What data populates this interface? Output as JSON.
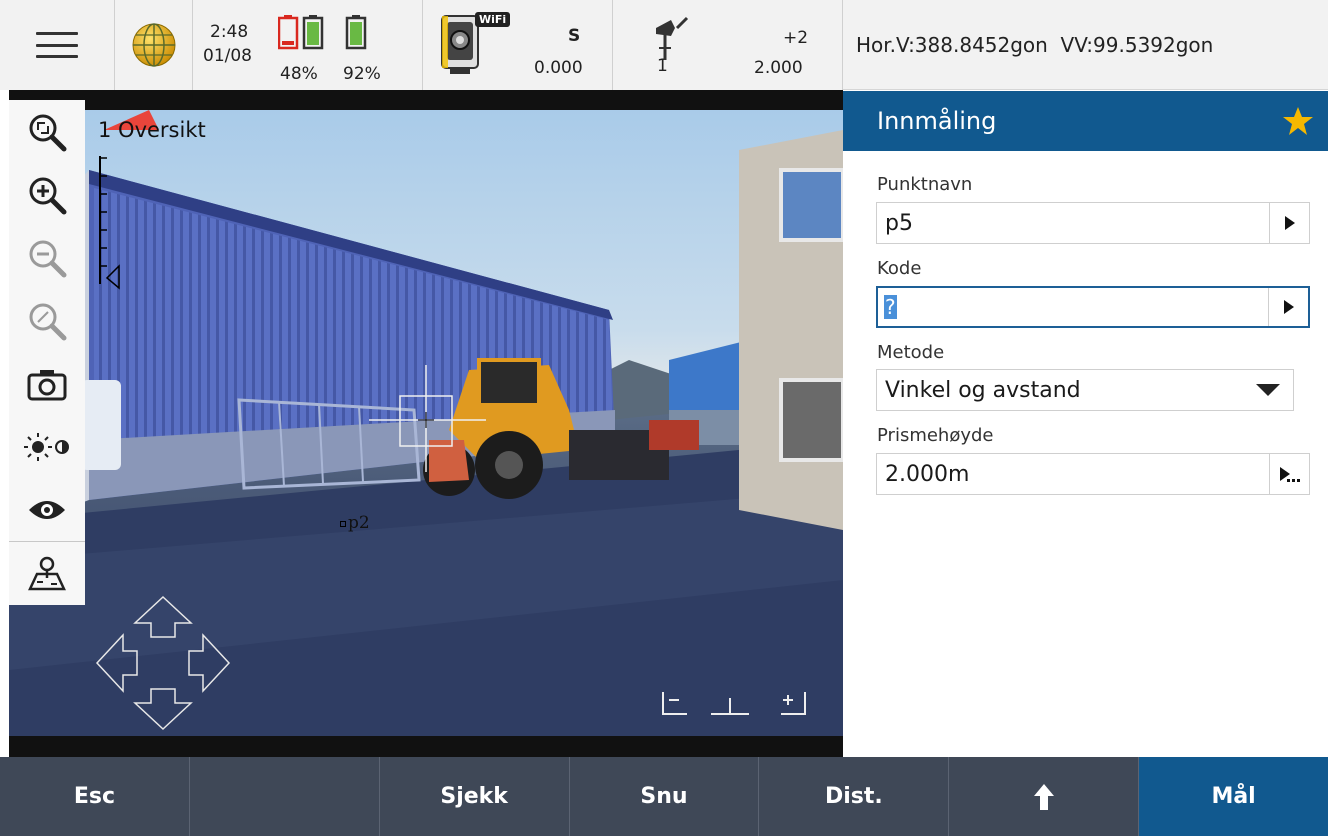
{
  "status": {
    "time": "2:48",
    "date": "01/08",
    "battery_left_pct": "48%",
    "battery_right_pct": "92%",
    "wifi_label": "WiFi",
    "instrument_face": "S",
    "instrument_value": "0.000",
    "target_number": "1",
    "target_offset": "+2",
    "target_height": "2.000",
    "icons": [
      "menu-icon",
      "globe-icon",
      "battery-icon",
      "total-station-icon",
      "prism-pole-icon"
    ]
  },
  "angles": {
    "text": "Hor.V:388.8452gon  VV:99.5392gon"
  },
  "video": {
    "view_label": "1 Oversikt",
    "point_label": "p2"
  },
  "toolbar_icons": [
    "zoom-to-extent-icon",
    "zoom-in-icon",
    "zoom-out-icon",
    "zoom-previous-icon",
    "camera-icon",
    "brightness-contrast-icon",
    "eye-icon",
    "map-pin-icon"
  ],
  "form": {
    "title": "Innmåling",
    "punktnavn_label": "Punktnavn",
    "punktnavn_value": "p5",
    "kode_label": "Kode",
    "kode_value": "?",
    "metode_label": "Metode",
    "metode_value": "Vinkel og avstand",
    "prisme_label": "Prismehøyde",
    "prisme_value": "2.000m"
  },
  "softkeys": {
    "esc": "Esc",
    "blank": "",
    "sjekk": "Sjekk",
    "snu": "Snu",
    "dist": "Dist.",
    "maal": "Mål"
  },
  "colors": {
    "accent_blue": "#11598f",
    "softkey_bg": "#3f4857",
    "star": "#f5b800",
    "battery_red": "#d9281f",
    "battery_green": "#69b944"
  }
}
